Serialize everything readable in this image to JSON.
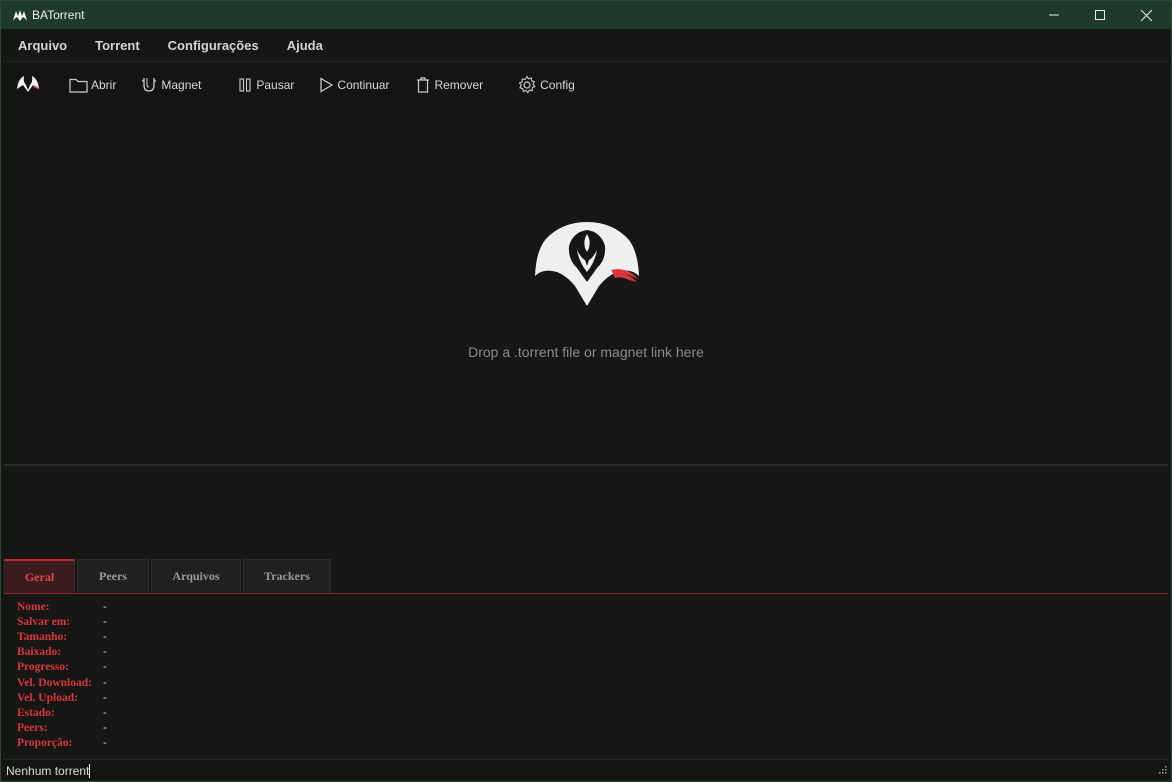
{
  "window": {
    "title": "BATorrent"
  },
  "menu": [
    "Arquivo",
    "Torrent",
    "Configurações",
    "Ajuda"
  ],
  "toolbar": {
    "open": "Abrir",
    "magnet": "Magnet",
    "pause": "Pausar",
    "resume": "Continuar",
    "remove": "Remover",
    "config": "Config"
  },
  "drop": {
    "text": "Drop a .torrent file or magnet link here"
  },
  "tabs": [
    "Geral",
    "Peers",
    "Arquivos",
    "Trackers"
  ],
  "details": [
    {
      "label": "Nome:",
      "value": "-"
    },
    {
      "label": "Salvar em:",
      "value": "-"
    },
    {
      "label": "Tamanho:",
      "value": "-"
    },
    {
      "label": "Baixado:",
      "value": "-"
    },
    {
      "label": "Progresso:",
      "value": "-"
    },
    {
      "label": "Vel. Download:",
      "value": "-"
    },
    {
      "label": "Vel. Upload:",
      "value": "-"
    },
    {
      "label": "Estado:",
      "value": "-"
    },
    {
      "label": "Peers:",
      "value": "-"
    },
    {
      "label": "Proporção:",
      "value": "-"
    }
  ],
  "status": {
    "text": "Nenhum torrent"
  },
  "colors": {
    "accent": "#d83838",
    "titlebar": "#1d3a2b",
    "background": "#161616"
  }
}
